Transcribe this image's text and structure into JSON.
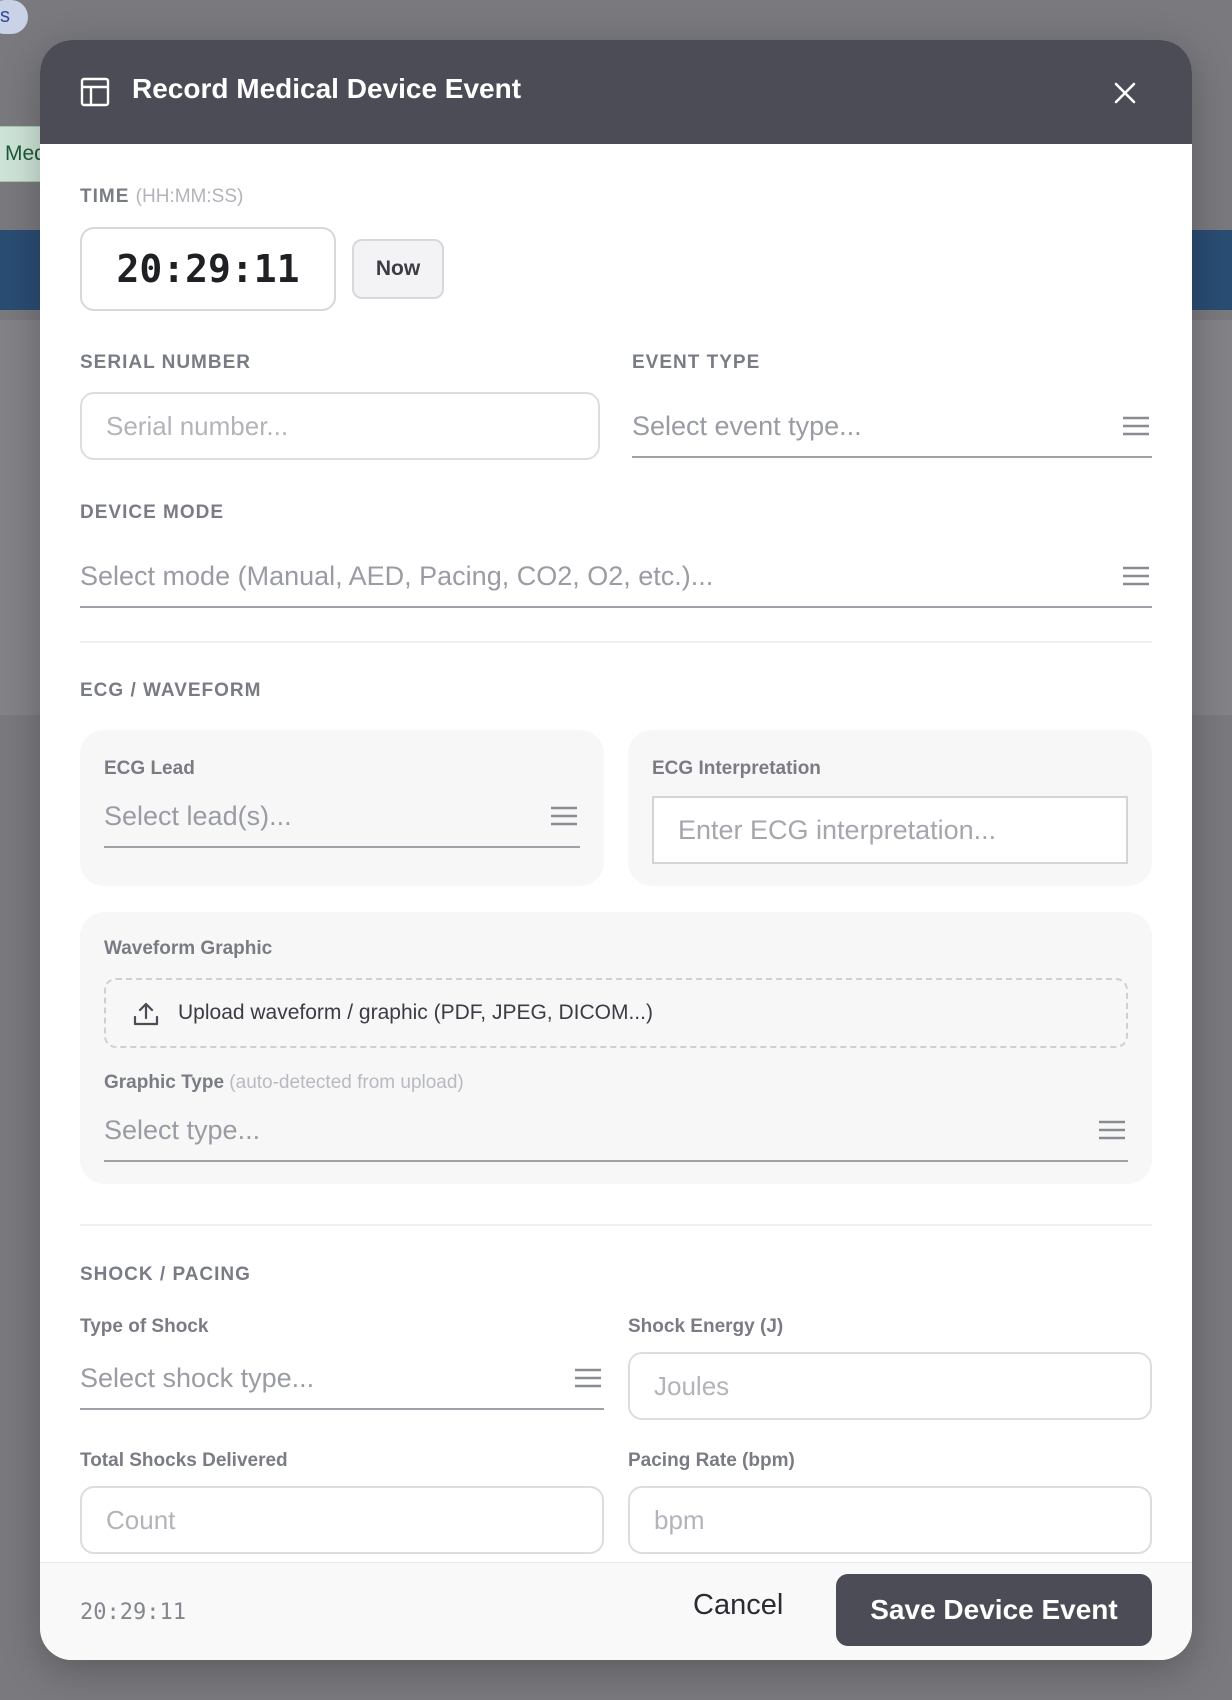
{
  "background": {
    "pill_text": "s",
    "tab_text": "Med"
  },
  "modal": {
    "title": "Record Medical Device Event",
    "header_icon": "table-layout-icon",
    "close_icon": "close-icon"
  },
  "time": {
    "label": "TIME",
    "hint": "(HH:MM:SS)",
    "value": "20:29:11",
    "now_label": "Now"
  },
  "serial_number": {
    "label": "SERIAL NUMBER",
    "placeholder": "Serial number..."
  },
  "event_type": {
    "label": "EVENT TYPE",
    "placeholder": "Select event type..."
  },
  "device_mode": {
    "label": "DEVICE MODE",
    "placeholder": "Select mode (Manual, AED, Pacing, CO2, O2, etc.)..."
  },
  "ecg": {
    "section_label": "ECG / WAVEFORM",
    "lead_label": "ECG Lead",
    "lead_placeholder": "Select lead(s)...",
    "interp_label": "ECG Interpretation",
    "interp_placeholder": "Enter ECG interpretation...",
    "waveform_label": "Waveform Graphic",
    "upload_label": "Upload waveform / graphic (PDF, JPEG, DICOM...)",
    "graphic_type_label": "Graphic Type",
    "graphic_type_hint": "(auto-detected from upload)",
    "graphic_type_placeholder": "Select type..."
  },
  "shock": {
    "section_label": "SHOCK / PACING",
    "type_label": "Type of Shock",
    "type_placeholder": "Select shock type...",
    "energy_label": "Shock Energy (J)",
    "energy_placeholder": "Joules",
    "total_label": "Total Shocks Delivered",
    "total_placeholder": "Count",
    "rate_label": "Pacing Rate (bpm)",
    "rate_placeholder": "bpm"
  },
  "footer": {
    "time": "20:29:11",
    "cancel_label": "Cancel",
    "save_label": "Save Device Event"
  }
}
